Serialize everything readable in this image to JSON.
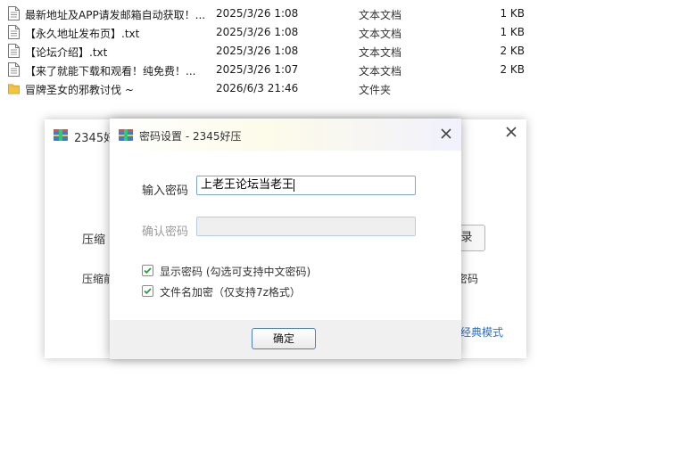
{
  "files": [
    {
      "name": "最新地址及APP请发邮箱自动获取！...",
      "date": "2025/3/26 1:08",
      "type": "文本文档",
      "size": "1 KB",
      "icon": "text-file-icon"
    },
    {
      "name": "【永久地址发布页】.txt",
      "date": "2025/3/26 1:08",
      "type": "文本文档",
      "size": "1 KB",
      "icon": "text-file-icon"
    },
    {
      "name": "【论坛介绍】.txt",
      "date": "2025/3/26 1:08",
      "type": "文本文档",
      "size": "2 KB",
      "icon": "text-file-icon"
    },
    {
      "name": "【来了就能下载和观看！纯免费！...",
      "date": "2025/3/26 1:07",
      "type": "文本文档",
      "size": "2 KB",
      "icon": "text-file-icon"
    },
    {
      "name": "冒牌圣女的邪教讨伐 ~",
      "date": "2026/6/3 21:46",
      "type": "文件夹",
      "size": "",
      "icon": "folder-icon"
    }
  ],
  "bg_window": {
    "title": "2345好",
    "label_compress": "压缩",
    "label_compress2": "压缩前",
    "button_right": "录",
    "text_right": "密码",
    "link_mode": "经典模式"
  },
  "dialog": {
    "title": "密码设置 - 2345好压",
    "password_label": "输入密码",
    "password_value": "上老王论坛当老王",
    "confirm_label": "确认密码",
    "confirm_value": "",
    "show_password_label": "显示密码 (勾选可支持中文密码)",
    "show_password_checked": true,
    "encrypt_filename_label": "文件名加密（仅支持7z格式）",
    "encrypt_filename_checked": true,
    "ok_label": "确定"
  },
  "colors": {
    "link": "#2a6fd6",
    "check": "#2e9e3e",
    "folder": "#f5c342",
    "input_border": "#7aa7d8"
  }
}
